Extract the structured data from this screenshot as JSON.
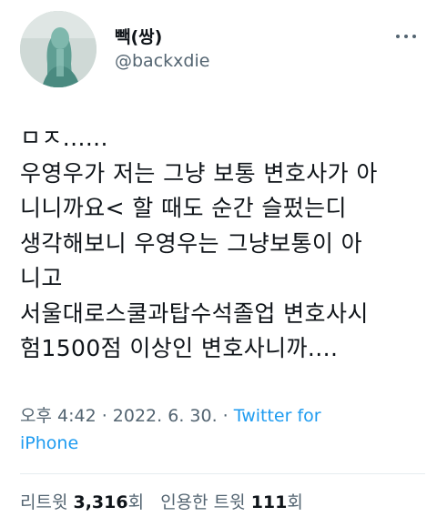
{
  "author": {
    "display_name": "빽(쌍)",
    "handle": "@backxdie",
    "avatar_icon": "profile-avatar-photo"
  },
  "tweet": {
    "lines": [
      "ㅁㅈ......",
      "우영우가 저는 그냥 보통 변호사가 아",
      "니니까요< 할 때도 순간 슬펐는디",
      "생각해보니 우영우는 그냥보통이 아",
      "니고",
      "서울대로스쿨과탑수석졸업 변호사시",
      "험1500점 이상인 변호사니까...."
    ]
  },
  "meta": {
    "time": "오후 4:42",
    "separator1": " · ",
    "date": "2022. 6. 30.",
    "separator2": " · ",
    "source_line1": "Twitter for",
    "source_line2": "iPhone"
  },
  "stats": {
    "retweets_label": "리트윗 ",
    "retweets_count": "3,316",
    "retweets_suffix": "회",
    "quotes_label": "인용한 트윗 ",
    "quotes_count": "111",
    "quotes_suffix": "회"
  },
  "colors": {
    "text": "#0f1419",
    "secondary": "#536471",
    "link": "#1d9bf0"
  }
}
